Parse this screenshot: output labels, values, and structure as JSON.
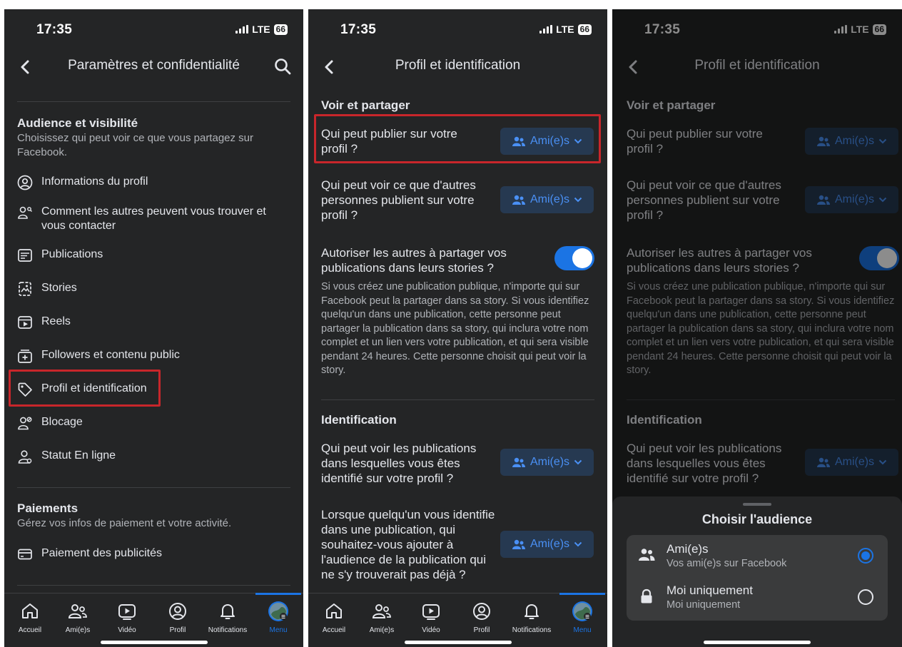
{
  "status": {
    "time": "17:35",
    "network": "LTE",
    "battery": "66"
  },
  "screen1": {
    "title": "Paramètres et confidentialité",
    "section_audience": {
      "title": "Audience et visibilité",
      "description": "Choisissez qui peut voir ce que vous partagez sur Facebook."
    },
    "items": [
      {
        "label": "Informations du profil",
        "icon": "user-circle-icon"
      },
      {
        "label": "Comment les autres peuvent vous trouver et vous contacter",
        "icon": "user-search-icon"
      },
      {
        "label": "Publications",
        "icon": "post-icon"
      },
      {
        "label": "Stories",
        "icon": "stories-icon"
      },
      {
        "label": "Reels",
        "icon": "reels-icon"
      },
      {
        "label": "Followers et contenu public",
        "icon": "followers-icon"
      },
      {
        "label": "Profil et identification",
        "icon": "tag-icon"
      },
      {
        "label": "Blocage",
        "icon": "block-user-icon"
      },
      {
        "label": "Statut En ligne",
        "icon": "online-status-icon"
      }
    ],
    "section_payments": {
      "title": "Paiements",
      "description": "Gérez vos infos de paiement et votre activité."
    },
    "payment_items": [
      {
        "label": "Paiement des publicités",
        "icon": "card-icon"
      }
    ]
  },
  "screen2": {
    "title": "Profil et identification",
    "section_share": "Voir et partager",
    "q_publish": "Qui peut publier sur votre profil ?",
    "q_see_others": "Qui peut voir ce que d'autres personnes publient sur votre profil ?",
    "q_allow_share": "Autoriser les autres à partager vos publications dans leurs stories ?",
    "allow_share_desc": "Si vous créez une publication publique, n'importe qui sur Facebook peut la partager dans sa story. Si vous identifiez quelqu'un dans une publication, cette personne peut partager la publication dans sa story, qui inclura votre nom complet et un lien vers votre publication, et qui sera visible pendant 24 heures. Cette personne choisit qui peut voir la story.",
    "section_tag": "Identification",
    "q_tagged_posts": "Qui peut voir les publications dans lesquelles vous êtes identifié sur votre profil ?",
    "q_add_audience": "Lorsque quelqu'un vous identifie dans une publication, qui souhaitez-vous ajouter à l'audience de la publication qui ne s'y trouverait pas déjà ?",
    "audience_value": "Ami(e)s",
    "toggle_on": true
  },
  "sheet": {
    "title": "Choisir l'audience",
    "options": [
      {
        "label": "Ami(e)s",
        "sub": "Vos ami(e)s sur Facebook",
        "selected": true,
        "icon": "friends-icon"
      },
      {
        "label": "Moi uniquement",
        "sub": "Moi uniquement",
        "selected": false,
        "icon": "lock-icon"
      }
    ]
  },
  "tabs": [
    {
      "label": "Accueil",
      "icon": "home-icon"
    },
    {
      "label": "Ami(e)s",
      "icon": "friends-icon"
    },
    {
      "label": "Vidéo",
      "icon": "video-icon"
    },
    {
      "label": "Profil",
      "icon": "profile-icon"
    },
    {
      "label": "Notifications",
      "icon": "bell-icon"
    },
    {
      "label": "Menu",
      "icon": "menu-avatar-icon"
    }
  ],
  "colors": {
    "bg": "#242526",
    "accent": "#1b74e4",
    "highlight": "#c8262b",
    "audience_btn": "#263951"
  }
}
